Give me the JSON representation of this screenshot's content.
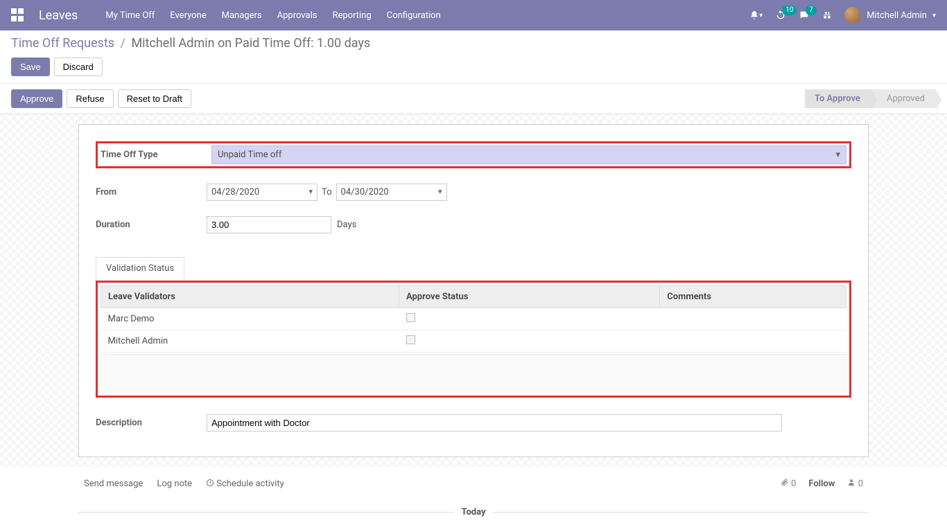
{
  "brand": "Leaves",
  "nav": {
    "items": [
      "My Time Off",
      "Everyone",
      "Managers",
      "Approvals",
      "Reporting",
      "Configuration"
    ],
    "badge_refresh": "10",
    "badge_chat": "7",
    "user": "Mitchell Admin"
  },
  "breadcrumb": {
    "root": "Time Off Requests",
    "current": "Mitchell Admin on Paid Time Off: 1.00 days"
  },
  "buttons": {
    "save": "Save",
    "discard": "Discard",
    "approve": "Approve",
    "refuse": "Refuse",
    "reset": "Reset to Draft"
  },
  "status": {
    "to_approve": "To Approve",
    "approved": "Approved"
  },
  "form": {
    "type_label": "Time Off Type",
    "type_value": "Unpaid Time off",
    "from_label": "From",
    "from_value": "04/28/2020",
    "to_label": "To",
    "to_value": "04/30/2020",
    "duration_label": "Duration",
    "duration_value": "3.00",
    "days_label": "Days",
    "description_label": "Description",
    "description_value": "Appointment with Doctor"
  },
  "tabs": {
    "validation": "Validation Status"
  },
  "table": {
    "col_validators": "Leave Validators",
    "col_approve": "Approve Status",
    "col_comments": "Comments",
    "rows": [
      {
        "name": "Marc Demo",
        "approved": false,
        "comments": ""
      },
      {
        "name": "Mitchell Admin",
        "approved": false,
        "comments": ""
      }
    ]
  },
  "chatter": {
    "send": "Send message",
    "log": "Log note",
    "schedule": "Schedule activity",
    "follow": "Follow",
    "attach_count": "0",
    "follower_count": "0",
    "today": "Today"
  }
}
